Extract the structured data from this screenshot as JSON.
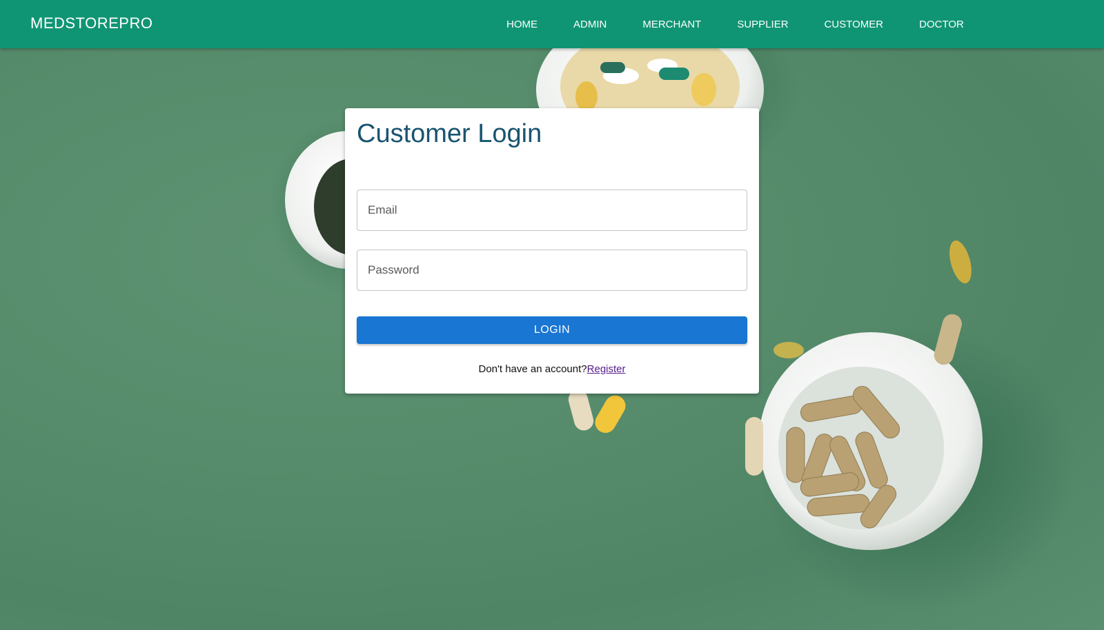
{
  "navbar": {
    "brand": "MEDSTOREPRO",
    "links": [
      "HOME",
      "ADMIN",
      "MERCHANT",
      "SUPPLIER",
      "CUSTOMER",
      "DOCTOR"
    ]
  },
  "login": {
    "title": "Customer Login",
    "email_placeholder": "Email",
    "email_value": "",
    "password_placeholder": "Password",
    "password_value": "",
    "login_label": "LOGIN",
    "register_prompt": "Don't have an account?",
    "register_link": "Register"
  },
  "colors": {
    "navbar": "#109574",
    "title": "#195470",
    "login_button": "#1976d2",
    "register_link": "#551a8b",
    "background": "#568c6b"
  }
}
